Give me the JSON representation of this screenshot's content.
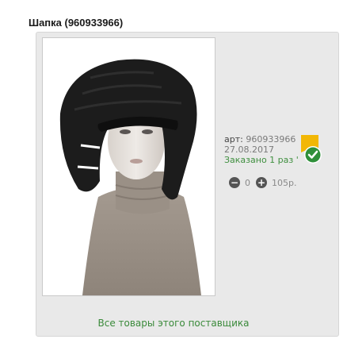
{
  "product": {
    "title": "Шапка (960933966)",
    "article_label": "арт:",
    "article_value": "960933966",
    "date": "27.08.2017",
    "ordered": "Заказано 1 раз",
    "ordered_mark": "'",
    "quantity": "0",
    "price": "105р."
  },
  "icons": {
    "minus": "minus-icon",
    "plus": "plus-icon",
    "badge": "checkmark-badge-icon"
  },
  "colors": {
    "badge_flag": "#f2b705",
    "badge_check": "#2f8f3a",
    "link": "#3a8a3a"
  },
  "footer": {
    "supplier_link": "Все товары этого поставщика"
  }
}
